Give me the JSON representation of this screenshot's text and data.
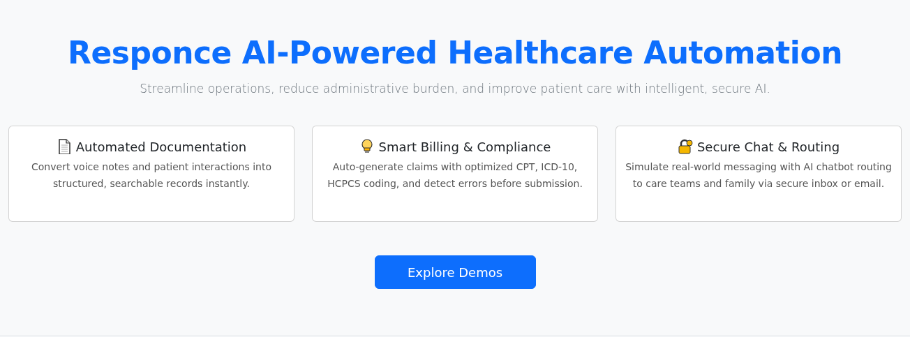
{
  "hero": {
    "title": "Responce AI-Powered Healthcare Automation",
    "subtitle": "Streamline operations, reduce administrative burden, and improve patient care with intelligent, secure AI."
  },
  "features": [
    {
      "kind": "document",
      "title": "Automated Documentation",
      "text": "Convert voice notes and patient interactions into structured, searchable records instantly."
    },
    {
      "kind": "bulb",
      "title": "Smart Billing & Compliance",
      "text": "Auto-generate claims with optimized CPT, ICD-10, HCPCS coding, and detect errors before submission."
    },
    {
      "kind": "lock",
      "title": "Secure Chat & Routing",
      "text": "Simulate real-world messaging with AI chatbot routing to care teams and family via secure inbox or email."
    }
  ],
  "cta": {
    "label": "Explore Demos"
  }
}
